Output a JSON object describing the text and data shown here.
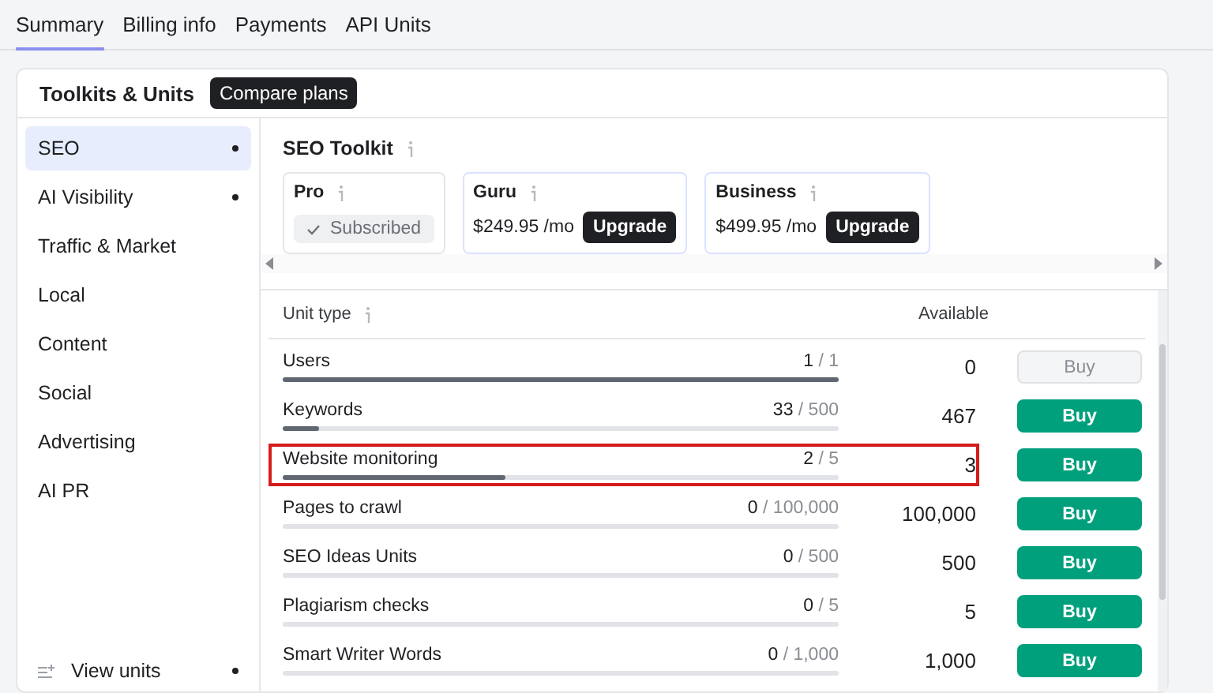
{
  "tabs": [
    {
      "label": "Summary",
      "selected": true
    },
    {
      "label": "Billing info",
      "selected": false
    },
    {
      "label": "Payments",
      "selected": false
    },
    {
      "label": "API Units",
      "selected": false
    }
  ],
  "card": {
    "title": "Toolkits & Units",
    "compare_button": "Compare plans"
  },
  "sidebar": {
    "items": [
      {
        "label": "SEO",
        "selected": true,
        "dot": true
      },
      {
        "label": "AI Visibility",
        "selected": false,
        "dot": true
      },
      {
        "label": "Traffic & Market",
        "selected": false,
        "dot": false
      },
      {
        "label": "Local",
        "selected": false,
        "dot": false
      },
      {
        "label": "Content",
        "selected": false,
        "dot": false
      },
      {
        "label": "Social",
        "selected": false,
        "dot": false
      },
      {
        "label": "Advertising",
        "selected": false,
        "dot": false
      },
      {
        "label": "AI PR",
        "selected": false,
        "dot": false
      }
    ],
    "footer": {
      "label": "View units",
      "dot": true
    }
  },
  "toolkit": {
    "title": "SEO Toolkit",
    "plans": [
      {
        "kind": "subscribed",
        "name": "Pro",
        "status": "Subscribed"
      },
      {
        "kind": "upgrade",
        "name": "Guru",
        "price": "$249.95 /mo",
        "button": "Upgrade"
      },
      {
        "kind": "upgrade",
        "name": "Business",
        "price": "$499.95 /mo",
        "button": "Upgrade"
      }
    ]
  },
  "table": {
    "columns": [
      "Unit type",
      "Available"
    ],
    "rows": [
      {
        "name": "Users",
        "used": "1",
        "total": "/ 1",
        "level": 1,
        "available": "0",
        "buy": "Buy",
        "disabled": true,
        "highlighted": false
      },
      {
        "name": "Keywords",
        "used": "33",
        "total": "/ 500",
        "level": 0.066,
        "available": "467",
        "buy": "Buy",
        "disabled": false,
        "highlighted": false
      },
      {
        "name": "Website monitoring",
        "used": "2",
        "total": "/ 5",
        "level": 0.4,
        "available": "3",
        "buy": "Buy",
        "disabled": false,
        "highlighted": true
      },
      {
        "name": "Pages to crawl",
        "used": "0",
        "total": "/ 100,000",
        "level": 0,
        "available": "100,000",
        "buy": "Buy",
        "disabled": false,
        "highlighted": false
      },
      {
        "name": "SEO Ideas Units",
        "used": "0",
        "total": "/ 500",
        "level": 0,
        "available": "500",
        "buy": "Buy",
        "disabled": false,
        "highlighted": false
      },
      {
        "name": "Plagiarism checks",
        "used": "0",
        "total": "/ 5",
        "level": 0,
        "available": "5",
        "buy": "Buy",
        "disabled": false,
        "highlighted": false
      },
      {
        "name": "Smart Writer Words",
        "used": "0",
        "total": "/ 1,000",
        "level": 0,
        "available": "1,000",
        "buy": "Buy",
        "disabled": false,
        "highlighted": false
      }
    ]
  }
}
